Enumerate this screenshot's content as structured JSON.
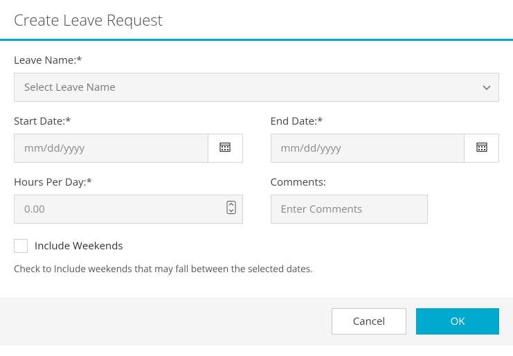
{
  "dialog": {
    "title": "Create Leave Request"
  },
  "fields": {
    "leave_name": {
      "label": "Leave Name:*",
      "placeholder": "Select Leave Name"
    },
    "start_date": {
      "label": "Start Date:*",
      "placeholder": "mm/dd/yyyy"
    },
    "end_date": {
      "label": "End Date:*",
      "placeholder": "mm/dd/yyyy"
    },
    "hours_per_day": {
      "label": "Hours Per Day:*",
      "placeholder": "0.00"
    },
    "comments": {
      "label": "Comments:",
      "placeholder": "Enter Comments"
    },
    "include_weekends": {
      "label": "Include Weekends",
      "helper": "Check to Include weekends that may fall between the selected dates."
    }
  },
  "footer": {
    "cancel": "Cancel",
    "ok": "OK"
  },
  "colors": {
    "accent": "#00aacf"
  }
}
